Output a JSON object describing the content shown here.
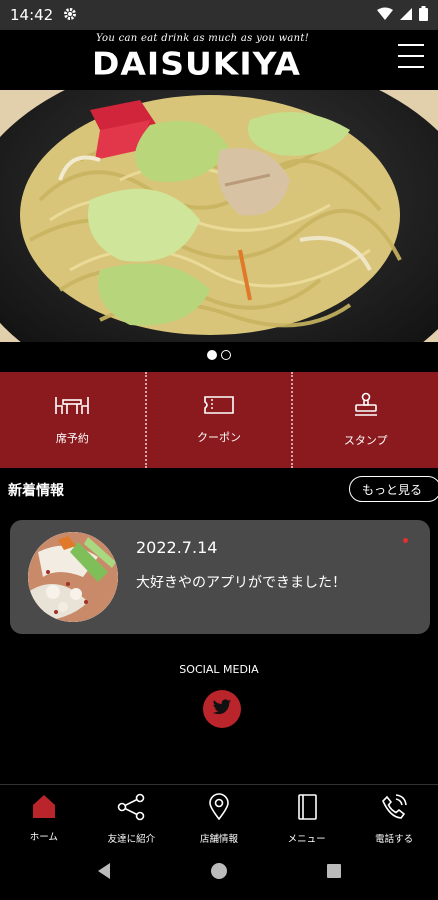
{
  "status_bar": {
    "time": "14:42"
  },
  "header": {
    "tagline": "You can eat drink as much as you want!",
    "logo": "DAISUKIYA"
  },
  "hero": {
    "slide_count": 2,
    "active_slide": 1
  },
  "actions": [
    {
      "label": "席予約",
      "icon": "table-icon"
    },
    {
      "label": "クーポン",
      "icon": "ticket-icon"
    },
    {
      "label": "スタンプ",
      "icon": "stamp-icon"
    }
  ],
  "news": {
    "title": "新着情報",
    "more_label": "もっと見る",
    "items": [
      {
        "date": "2022.7.14",
        "text": "大好きやのアプリができました！"
      }
    ]
  },
  "social": {
    "label": "SOCIAL MEDIA",
    "icon": "twitter-icon"
  },
  "bottom_nav": [
    {
      "label": "ホーム",
      "icon": "home-icon",
      "active": true
    },
    {
      "label": "友達に紹介",
      "icon": "share-icon"
    },
    {
      "label": "店舗情報",
      "icon": "location-pin-icon"
    },
    {
      "label": "メニュー",
      "icon": "book-icon"
    },
    {
      "label": "電話する",
      "icon": "phone-icon"
    }
  ],
  "colors": {
    "accent": "#8b1a1f",
    "active_nav": "#b9252b",
    "card_bg": "#4a4a4a"
  }
}
